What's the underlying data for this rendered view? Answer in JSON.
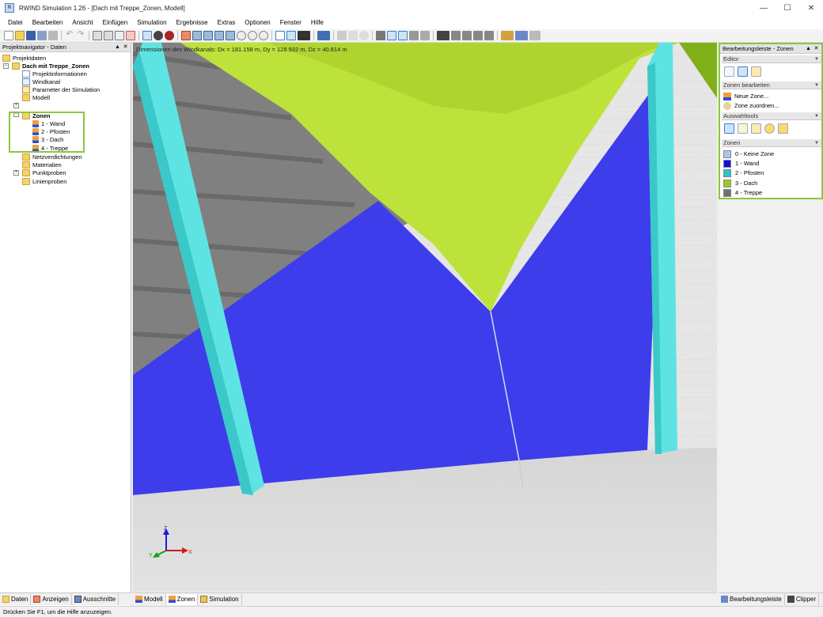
{
  "window": {
    "title": "RWIND Simulation 1.26 - [Dach mit Treppe_Zonen, Modell]",
    "controls": [
      "—",
      "☐",
      "✕"
    ]
  },
  "menu": [
    "Datei",
    "Bearbeiten",
    "Ansicht",
    "Einfügen",
    "Simulation",
    "Ergebnisse",
    "Extras",
    "Optionen",
    "Fenster",
    "Hilfe"
  ],
  "left_panel": {
    "header": "Projektnavigator - Daten",
    "tree": [
      {
        "label": "Projektdaten",
        "icon": "folder-icon"
      },
      {
        "label": "Dach mit Treppe_Zonen",
        "icon": "folder-icon",
        "bold": true
      },
      {
        "label": "Projektinformationen",
        "icon": "info-icon"
      },
      {
        "label": "Windkanal",
        "icon": "wind-tunnel-icon"
      },
      {
        "label": "Parameter der Simulation",
        "icon": "parameter-icon"
      },
      {
        "label": "Modell",
        "icon": "folder-icon"
      },
      {
        "label": "Zonen",
        "icon": "folder-icon",
        "bold": true
      },
      {
        "label": "1 - Wand",
        "icon": "zone-icon"
      },
      {
        "label": "2 - Pfosten",
        "icon": "zone-icon"
      },
      {
        "label": "3 - Dach",
        "icon": "zone-icon"
      },
      {
        "label": "4 - Treppe",
        "icon": "zone-icon"
      },
      {
        "label": "Netzverdichtungen",
        "icon": "folder-icon"
      },
      {
        "label": "Materialien",
        "icon": "folder-icon"
      },
      {
        "label": "Punktproben",
        "icon": "folder-icon"
      },
      {
        "label": "Linienproben",
        "icon": "folder-icon"
      }
    ],
    "tabs": [
      "Daten",
      "Anzeigen",
      "Ausschnitte"
    ]
  },
  "viewport": {
    "dimensions_text": "Dimensionen des Windkanals: Dx = 181.158 m, Dy = 128.932 m, Dz = 40.814 m",
    "axes": {
      "x": "X",
      "y": "Y",
      "z": "Z"
    },
    "tabs": [
      "Modell",
      "Zonen",
      "Simulation"
    ]
  },
  "right_panel": {
    "header": "Bearbeitungsleiste - Zonen",
    "sections": {
      "editor": "Editor",
      "zonen_bearbeiten": "Zonen bearbeiten",
      "auswahltools": "Auswahltools",
      "zonen": "Zonen"
    },
    "actions": [
      "Neue Zone...",
      "Zone zuordnen..."
    ],
    "zones": [
      {
        "label": "0 - Keine Zone",
        "color": "#a9c7ec"
      },
      {
        "label": "1 - Wand",
        "color": "#1010e0"
      },
      {
        "label": "2 - Pfosten",
        "color": "#2bc4c4"
      },
      {
        "label": "3 - Dach",
        "color": "#9ecb22"
      },
      {
        "label": "4 - Treppe",
        "color": "#707070"
      }
    ],
    "tabs": [
      "Bearbeitungsleiste",
      "Clipper"
    ]
  },
  "status": "Drücken Sie F1, um die Hilfe anzuzeigen."
}
